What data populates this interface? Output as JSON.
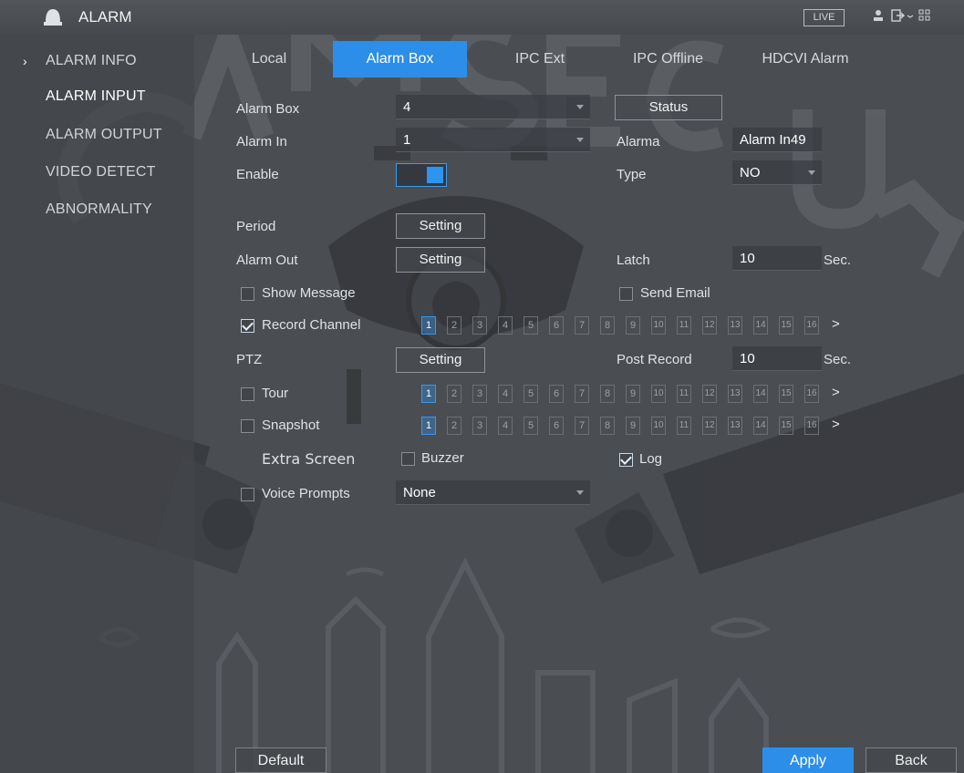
{
  "titlebar": {
    "title": "ALARM",
    "live_label": "LIVE",
    "icons": [
      "alarm-bell-icon",
      "user-icon",
      "logout-icon",
      "grid-menu-icon"
    ]
  },
  "sidebar": {
    "items": [
      {
        "label": "ALARM INFO"
      },
      {
        "label": "ALARM INPUT"
      },
      {
        "label": "ALARM OUTPUT"
      },
      {
        "label": "VIDEO DETECT"
      },
      {
        "label": "ABNORMALITY"
      }
    ],
    "selected": "ALARM INPUT"
  },
  "tabs": [
    {
      "label": "Local"
    },
    {
      "label": "Alarm Box"
    },
    {
      "label": "IPC Ext"
    },
    {
      "label": "IPC Offline"
    },
    {
      "label": "HDCVI Alarm"
    }
  ],
  "active_tab": "Alarm Box",
  "form": {
    "alarm_box": {
      "label": "Alarm Box",
      "value": "4"
    },
    "status_button": "Status",
    "alarm_in": {
      "label": "Alarm In",
      "value": "1"
    },
    "alarm_name": {
      "label": "Alarma",
      "value": "Alarm In49"
    },
    "enable": {
      "label": "Enable",
      "on": true
    },
    "type": {
      "label": "Type",
      "value": "NO"
    },
    "period": {
      "label": "Period",
      "button": "Setting"
    },
    "alarm_out": {
      "label": "Alarm Out",
      "button": "Setting"
    },
    "latch": {
      "label": "Latch",
      "value": "10",
      "unit": "Sec."
    },
    "show_message": {
      "label": "Show Message",
      "checked": false
    },
    "send_email": {
      "label": "Send Email",
      "checked": false
    },
    "record_channel": {
      "label": "Record Channel",
      "checked": true
    },
    "ptz": {
      "label": "PTZ",
      "button": "Setting"
    },
    "post_record": {
      "label": "Post Record",
      "value": "10",
      "unit": "Sec."
    },
    "tour": {
      "label": "Tour",
      "checked": false
    },
    "snapshot": {
      "label": "Snapshot",
      "checked": false
    },
    "extra_screen": {
      "label": "Extra Screen"
    },
    "buzzer": {
      "label": "Buzzer",
      "checked": false
    },
    "log": {
      "label": "Log",
      "checked": true
    },
    "voice_prompts": {
      "label": "Voice Prompts",
      "checked": false,
      "value": "None"
    }
  },
  "channels": {
    "labels": [
      "1",
      "2",
      "3",
      "4",
      "5",
      "6",
      "7",
      "8",
      "9",
      "10",
      "11",
      "12",
      "13",
      "14",
      "15",
      "16"
    ],
    "record_selected": [
      "1"
    ],
    "tour_selected": [
      "1"
    ],
    "snapshot_selected": [
      "1"
    ],
    "more_arrow": ">"
  },
  "bottom": {
    "default_label": "Default",
    "apply_label": "Apply",
    "back_label": "Back"
  },
  "colors": {
    "accent": "#2c8ee8",
    "background": "#4a4d52",
    "sidebar": "#42454a"
  }
}
